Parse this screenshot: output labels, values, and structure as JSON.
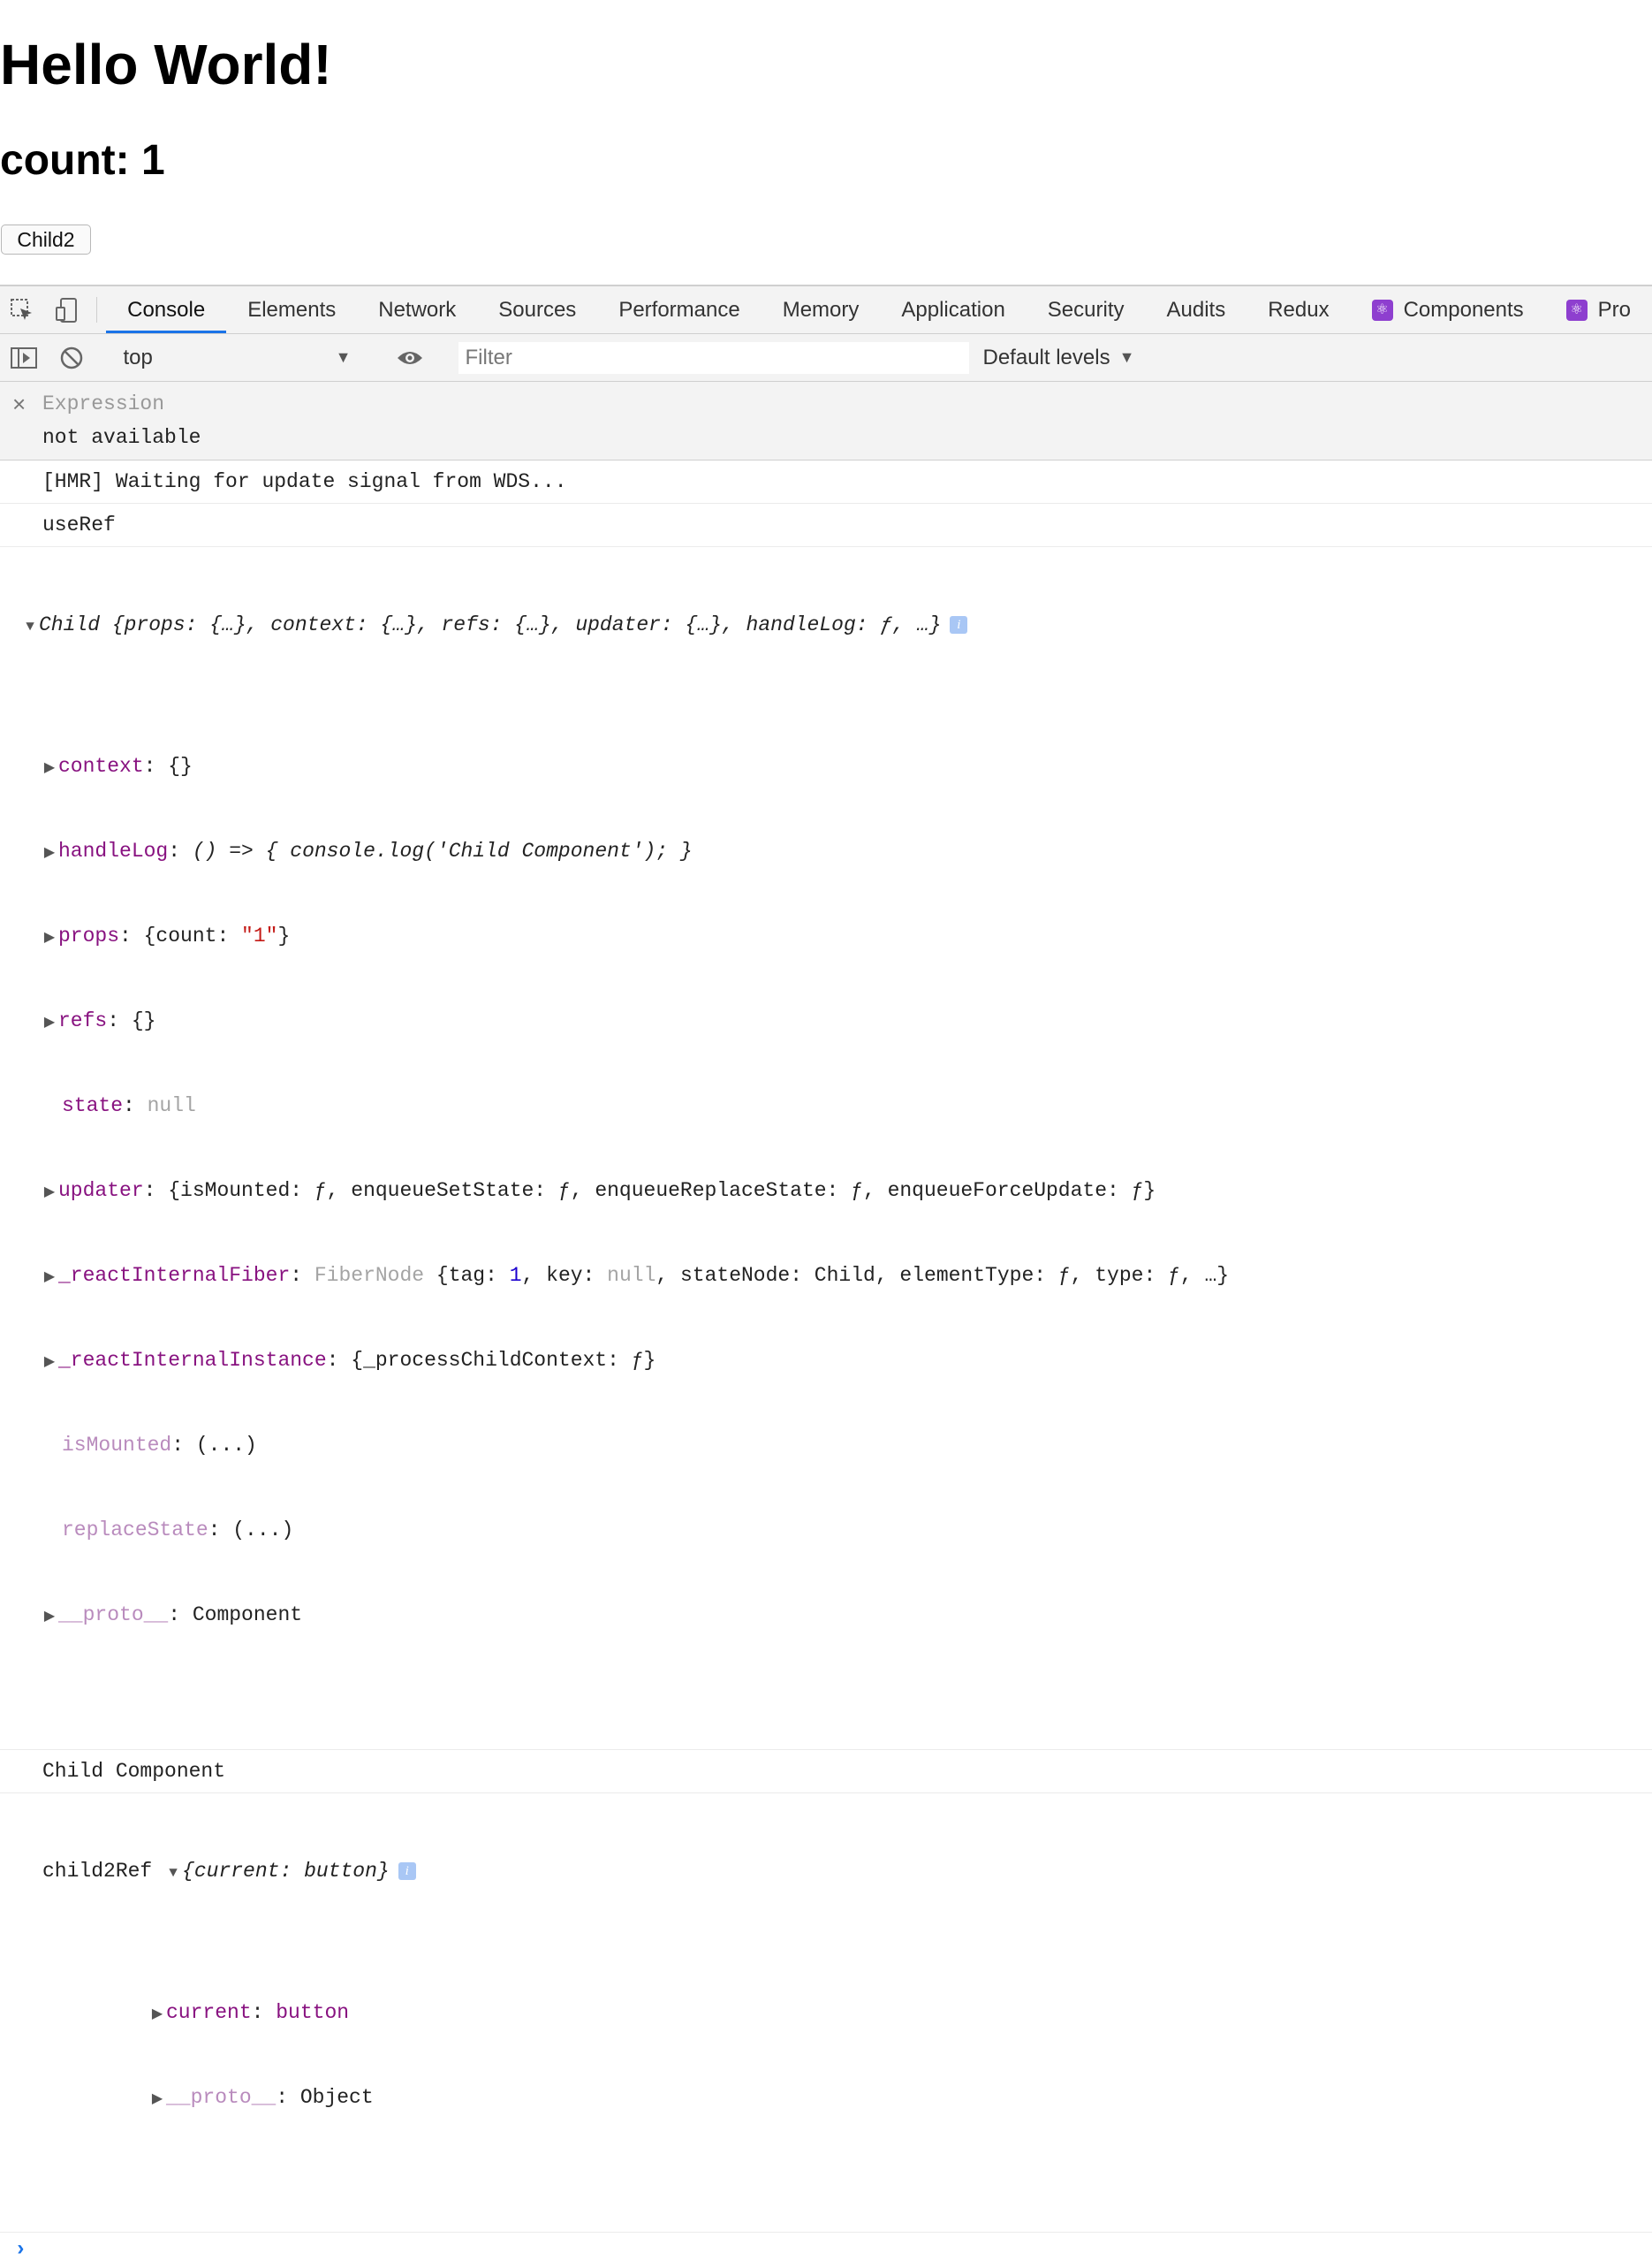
{
  "page": {
    "heading": "Hello World!",
    "count_text": "count: 1",
    "button_label": "Child2"
  },
  "devtools": {
    "tabs": [
      "Console",
      "Elements",
      "Network",
      "Sources",
      "Performance",
      "Memory",
      "Application",
      "Security",
      "Audits",
      "Redux",
      "Components",
      "Pro"
    ],
    "active_tab": "Console",
    "toolbar": {
      "context": "top",
      "filter_placeholder": "Filter",
      "levels_label": "Default levels"
    },
    "expression": {
      "name": "Expression",
      "value": "not available"
    },
    "console": {
      "hmr": "[HMR] Waiting for update signal from WDS...",
      "useref": "useRef",
      "child_obj": {
        "class_name": "Child",
        "summary": "{props: {…}, context: {…}, refs: {…}, updater: {…}, handleLog: ƒ, …}",
        "props": [
          {
            "key": "context",
            "value": "{}"
          },
          {
            "key": "handleLog",
            "value": "() => { console.log('Child Component'); }"
          },
          {
            "key": "props",
            "value_pre": "{count: ",
            "value_str": "\"1\"",
            "value_post": "}"
          },
          {
            "key": "refs",
            "value": "{}"
          },
          {
            "key": "state",
            "value": "null"
          },
          {
            "key": "updater",
            "value": "{isMounted: ƒ, enqueueSetState: ƒ, enqueueReplaceState: ƒ, enqueueForceUpdate: ƒ}"
          },
          {
            "key": "_reactInternalFiber",
            "value_type": "FiberNode",
            "value_a": " {tag: ",
            "value_num": "1",
            "value_b": ", key: ",
            "value_null": "null",
            "value_c": ", stateNode: Child, elementType: ƒ, type: ƒ, …}"
          },
          {
            "key": "_reactInternalInstance",
            "value": "{_processChildContext: ƒ}"
          },
          {
            "key": "isMounted",
            "value": "(...)"
          },
          {
            "key": "replaceState",
            "value": "(...)"
          },
          {
            "key": "__proto__",
            "value": "Component"
          }
        ]
      },
      "child_component": "Child Component",
      "child2ref": {
        "label": "child2Ref",
        "summary": "{current: button}",
        "current_key": "current",
        "current_val": "button",
        "proto_key": "__proto__",
        "proto_val": "Object"
      }
    }
  }
}
